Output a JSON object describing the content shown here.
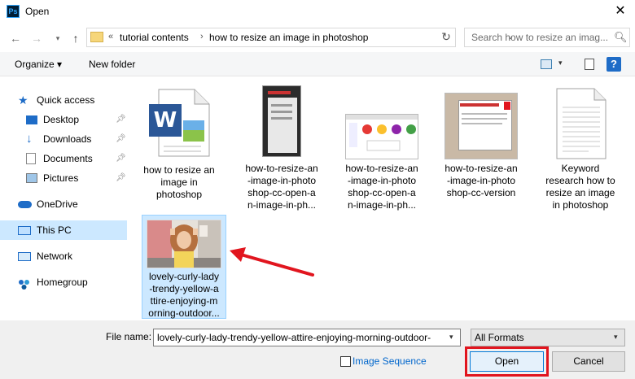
{
  "window": {
    "title": "Open",
    "app_icon": "Ps"
  },
  "address": {
    "crumbs": [
      "tutorial contents",
      "how to resize an image in photoshop"
    ],
    "overflow": "«"
  },
  "search": {
    "placeholder": "Search how to resize an imag..."
  },
  "toolbar": {
    "organize": "Organize ▾",
    "new_folder": "New folder"
  },
  "sidebar": {
    "items": [
      {
        "label": "Quick access",
        "icon": "star-icon",
        "pinned": false
      },
      {
        "label": "Desktop",
        "icon": "desktop-icon",
        "pinned": true
      },
      {
        "label": "Downloads",
        "icon": "download-icon",
        "pinned": true
      },
      {
        "label": "Documents",
        "icon": "documents-icon",
        "pinned": true
      },
      {
        "label": "Pictures",
        "icon": "pictures-icon",
        "pinned": true
      },
      {
        "label": "OneDrive",
        "icon": "cloud-icon",
        "pinned": false
      },
      {
        "label": "This PC",
        "icon": "computer-icon",
        "pinned": false,
        "selected": true
      },
      {
        "label": "Network",
        "icon": "network-icon",
        "pinned": false
      },
      {
        "label": "Homegroup",
        "icon": "homegroup-icon",
        "pinned": false
      }
    ]
  },
  "files": [
    {
      "name_lines": [
        "how to resize an",
        "image in",
        "photoshop"
      ],
      "type": "word-doc"
    },
    {
      "name_lines": [
        "how-to-resize-an",
        "-image-in-photo",
        "shop-cc-open-a",
        "n-image-in-ph..."
      ],
      "type": "screenshot"
    },
    {
      "name_lines": [
        "how-to-resize-an",
        "-image-in-photo",
        "shop-cc-open-a",
        "n-image-in-ph..."
      ],
      "type": "screenshot"
    },
    {
      "name_lines": [
        "how-to-resize-an",
        "-image-in-photo",
        "shop-cc-version"
      ],
      "type": "screenshot"
    },
    {
      "name_lines": [
        "Keyword",
        "research how to",
        "resize an image",
        "in photoshop"
      ],
      "type": "text-doc"
    },
    {
      "name_lines": [
        "lovely-curly-lady",
        "-trendy-yellow-a",
        "ttire-enjoying-m",
        "orning-outdoor..."
      ],
      "type": "photo",
      "selected": true
    }
  ],
  "bottom": {
    "file_name_label": "File name:",
    "file_name_value": "lovely-curly-lady-trendy-yellow-attire-enjoying-morning-outdoor-",
    "format": "All Formats",
    "image_sequence": "Image Sequence",
    "open": "Open",
    "cancel": "Cancel"
  },
  "colors": {
    "selection": "#cce8ff",
    "annotation": "#e1151e",
    "accent": "#0078d7"
  }
}
